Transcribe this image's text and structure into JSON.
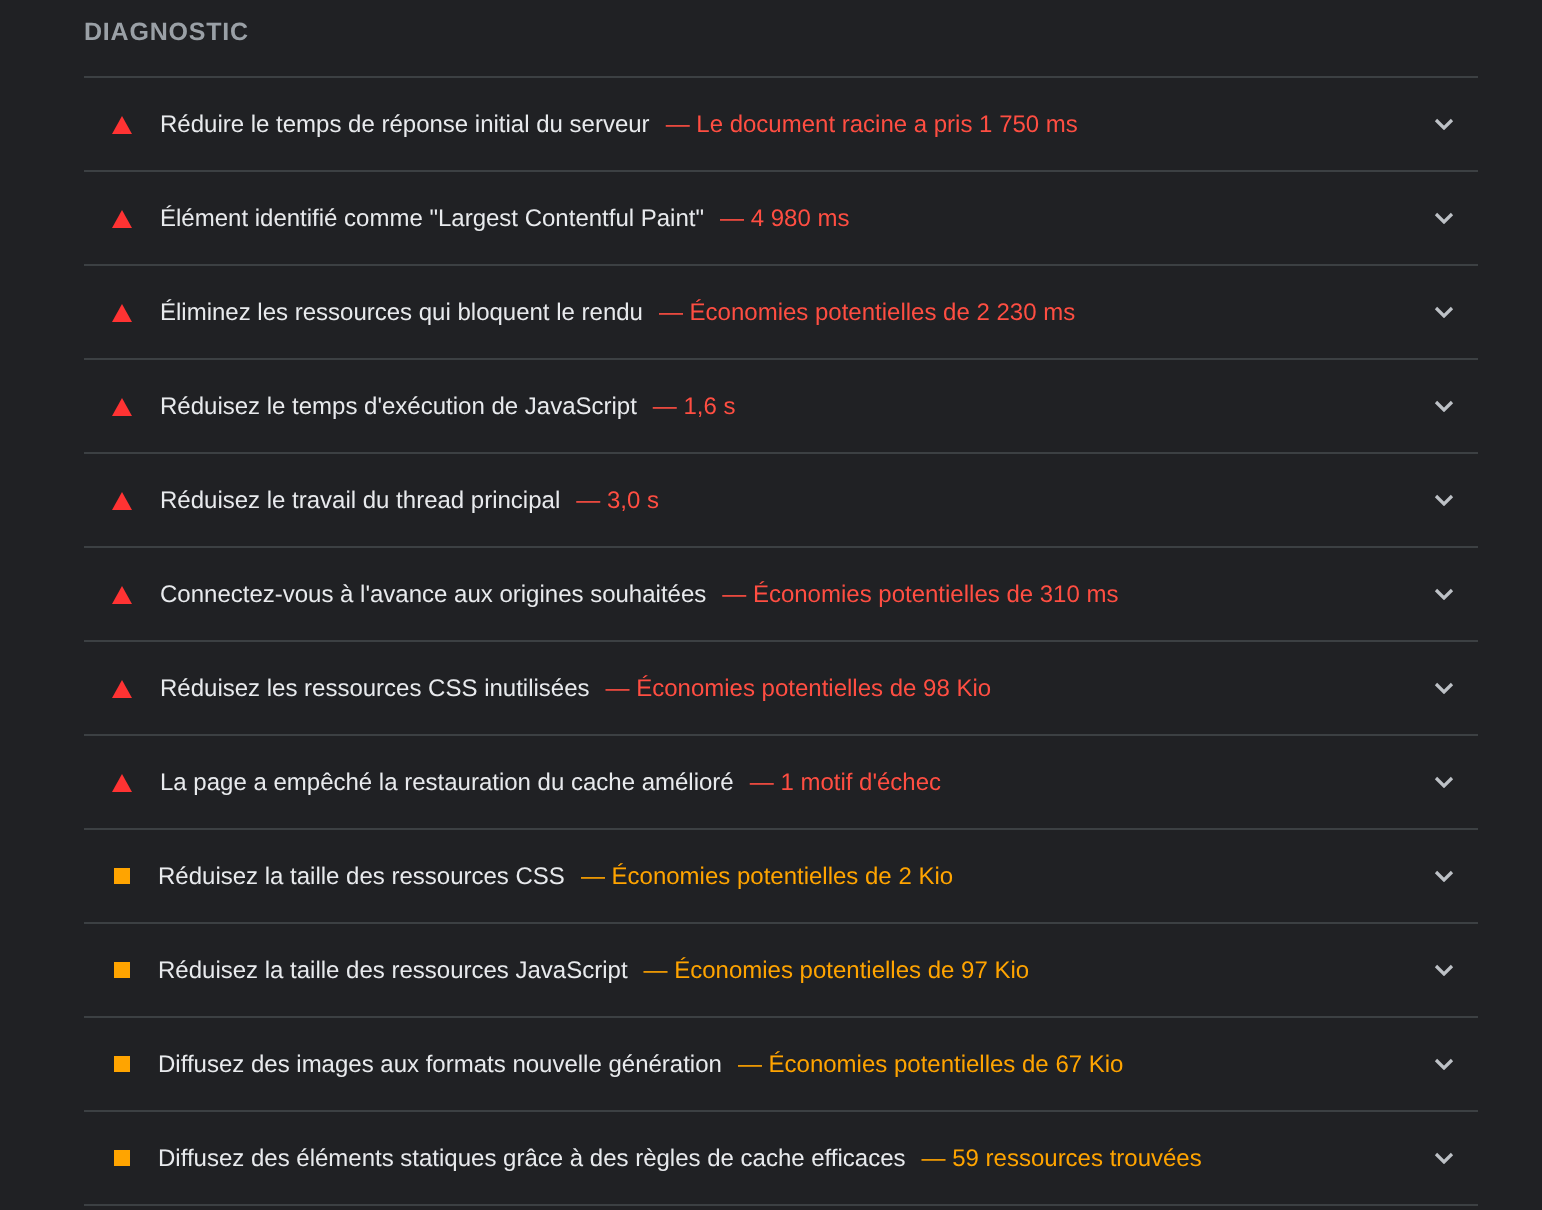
{
  "section_title": "DIAGNOSTIC",
  "audits": [
    {
      "kind": "fail",
      "title": "Réduire le temps de réponse initial du serveur",
      "display": "— Le document racine a pris 1 750 ms",
      "expanded": false
    },
    {
      "kind": "fail",
      "title": "Élément identifié comme \"Largest Contentful Paint\"",
      "display": "— 4 980 ms",
      "expanded": false
    },
    {
      "kind": "fail",
      "title": "Éliminez les ressources qui bloquent le rendu",
      "display": "— Économies potentielles de 2 230 ms",
      "expanded": false
    },
    {
      "kind": "fail",
      "title": "Réduisez le temps d'exécution de JavaScript",
      "display": "— 1,6 s",
      "expanded": false
    },
    {
      "kind": "fail",
      "title": "Réduisez le travail du thread principal",
      "display": "— 3,0 s",
      "expanded": false
    },
    {
      "kind": "fail",
      "title": "Connectez-vous à l'avance aux origines souhaitées",
      "display": "— Économies potentielles de 310 ms",
      "expanded": false
    },
    {
      "kind": "fail",
      "title": "Réduisez les ressources CSS inutilisées",
      "display": "— Économies potentielles de 98 Kio",
      "expanded": false
    },
    {
      "kind": "fail",
      "title": "La page a empêché la restauration du cache amélioré",
      "display": "— 1 motif d'échec",
      "expanded": false
    },
    {
      "kind": "average",
      "title": "Réduisez la taille des ressources CSS",
      "display": "— Économies potentielles de 2 Kio",
      "expanded": false
    },
    {
      "kind": "average",
      "title": "Réduisez la taille des ressources JavaScript",
      "display": "— Économies potentielles de 97 Kio",
      "expanded": false
    },
    {
      "kind": "average",
      "title": "Diffusez des images aux formats nouvelle génération",
      "display": "— Économies potentielles de 67 Kio",
      "expanded": false
    },
    {
      "kind": "average",
      "title": "Diffusez des éléments statiques grâce à des règles de cache efficaces",
      "display": "— 59 ressources trouvées",
      "expanded": false
    }
  ]
}
